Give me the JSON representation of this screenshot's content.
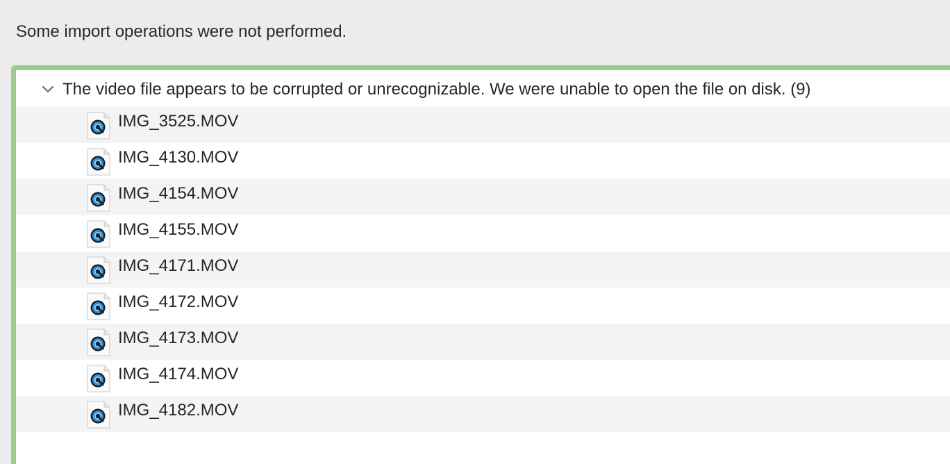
{
  "message": "Some import operations were not performed.",
  "group": {
    "label": "The video file appears to be corrupted or unrecognizable. We were unable to open the file on disk. (9)",
    "expanded": true,
    "icon": "chevron-down-icon"
  },
  "files": [
    {
      "name": "IMG_3525.MOV",
      "icon": "quicktime-movie-file-icon"
    },
    {
      "name": "IMG_4130.MOV",
      "icon": "quicktime-movie-file-icon"
    },
    {
      "name": "IMG_4154.MOV",
      "icon": "quicktime-movie-file-icon"
    },
    {
      "name": "IMG_4155.MOV",
      "icon": "quicktime-movie-file-icon"
    },
    {
      "name": "IMG_4171.MOV",
      "icon": "quicktime-movie-file-icon"
    },
    {
      "name": "IMG_4172.MOV",
      "icon": "quicktime-movie-file-icon"
    },
    {
      "name": "IMG_4173.MOV",
      "icon": "quicktime-movie-file-icon"
    },
    {
      "name": "IMG_4174.MOV",
      "icon": "quicktime-movie-file-icon"
    },
    {
      "name": "IMG_4182.MOV",
      "icon": "quicktime-movie-file-icon"
    }
  ],
  "colors": {
    "focus_border": "#9ccb8a",
    "row_alt": "#f4f4f4",
    "window_bg": "#ececec"
  }
}
